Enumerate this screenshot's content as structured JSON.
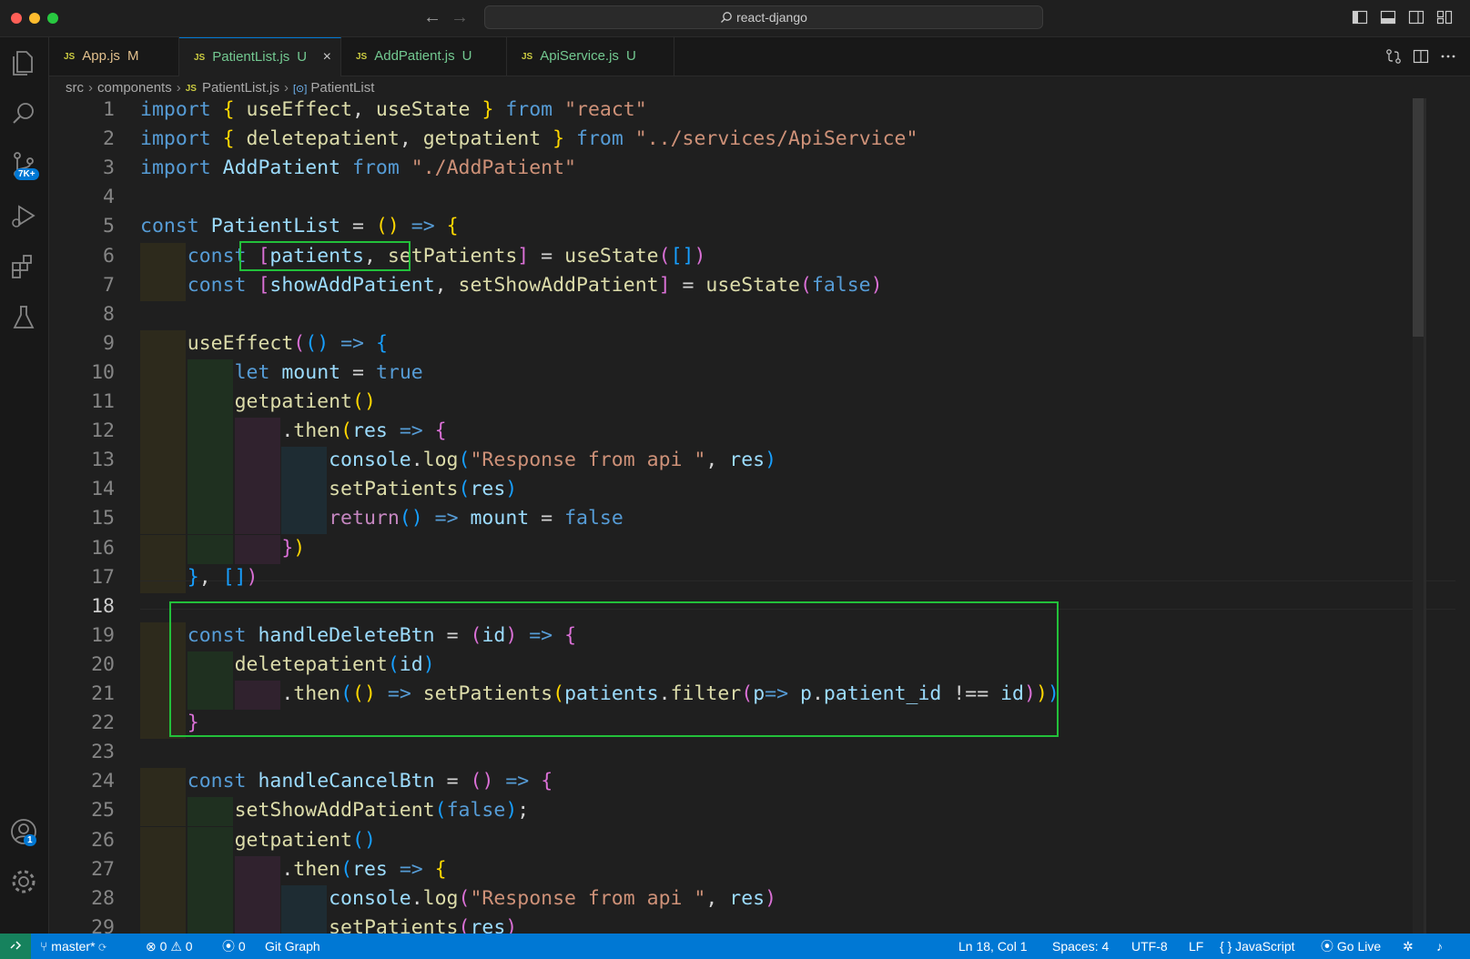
{
  "window": {
    "title": "react-django"
  },
  "tabs": [
    {
      "name": "App.js",
      "status": "M",
      "color": "#e2c08d"
    },
    {
      "name": "PatientList.js",
      "status": "U",
      "color": "#73c991",
      "active": true
    },
    {
      "name": "AddPatient.js",
      "status": "U",
      "color": "#73c991"
    },
    {
      "name": "ApiService.js",
      "status": "U",
      "color": "#73c991"
    }
  ],
  "tab_close": "×",
  "file_type_label": "JS",
  "breadcrumb": {
    "folder1": "src",
    "folder2": "components",
    "file": "PatientList.js",
    "symbol": "PatientList",
    "symbol_icon": "[⊙]"
  },
  "activity": {
    "scm_badge": "7K+",
    "accounts_badge": "1"
  },
  "editor": {
    "line_numbers": [
      "1",
      "2",
      "3",
      "4",
      "5",
      "6",
      "7",
      "8",
      "9",
      "10",
      "11",
      "12",
      "13",
      "14",
      "15",
      "16",
      "17",
      "18",
      "19",
      "20",
      "21",
      "22",
      "23",
      "24",
      "25",
      "26",
      "27",
      "28",
      "29"
    ],
    "current_line": 18,
    "lines": [
      "import { useEffect, useState } from \"react\"",
      "import { deletepatient, getpatient } from \"../services/ApiService\"",
      "import AddPatient from \"./AddPatient\"",
      "",
      "const PatientList = () => {",
      "    const [patients, setPatients] = useState([])",
      "    const [showAddPatient, setShowAddPatient] = useState(false)",
      "",
      "    useEffect(() => {",
      "        let mount = true",
      "        getpatient()",
      "            .then(res => {",
      "                console.log(\"Response from api \", res)",
      "                setPatients(res)",
      "                return() => mount = false",
      "            })",
      "    }, [])",
      "",
      "    const handleDeleteBtn = (id) => {",
      "        deletepatient(id)",
      "            .then(() => setPatients(patients.filter(p=> p.patient_id !== id)))",
      "    }",
      "",
      "    const handleCancelBtn = () => {",
      "        setShowAddPatient(false);",
      "        getpatient()",
      "            .then(res => {",
      "                console.log(\"Response from api \", res)",
      "                setPatients(res)"
    ]
  },
  "status": {
    "branch": "master*",
    "errors": "0",
    "warnings": "0",
    "ports": "0",
    "git_graph": "Git Graph",
    "position": "Ln 18, Col 1",
    "spaces": "Spaces: 4",
    "encoding": "UTF-8",
    "eol": "LF",
    "language_icon": "{ }",
    "language": "JavaScript",
    "go_live": "Go Live"
  },
  "icons": {
    "explorer": "files-icon",
    "search": "search-icon",
    "scm": "source-control-icon",
    "debug": "run-debug-icon",
    "extensions": "extensions-icon",
    "testing": "flask-icon",
    "accounts": "account-icon",
    "settings": "gear-icon"
  },
  "colors": {
    "accent": "#0078d4",
    "highlight_box": "#22c03a",
    "remote": "#16825d"
  }
}
